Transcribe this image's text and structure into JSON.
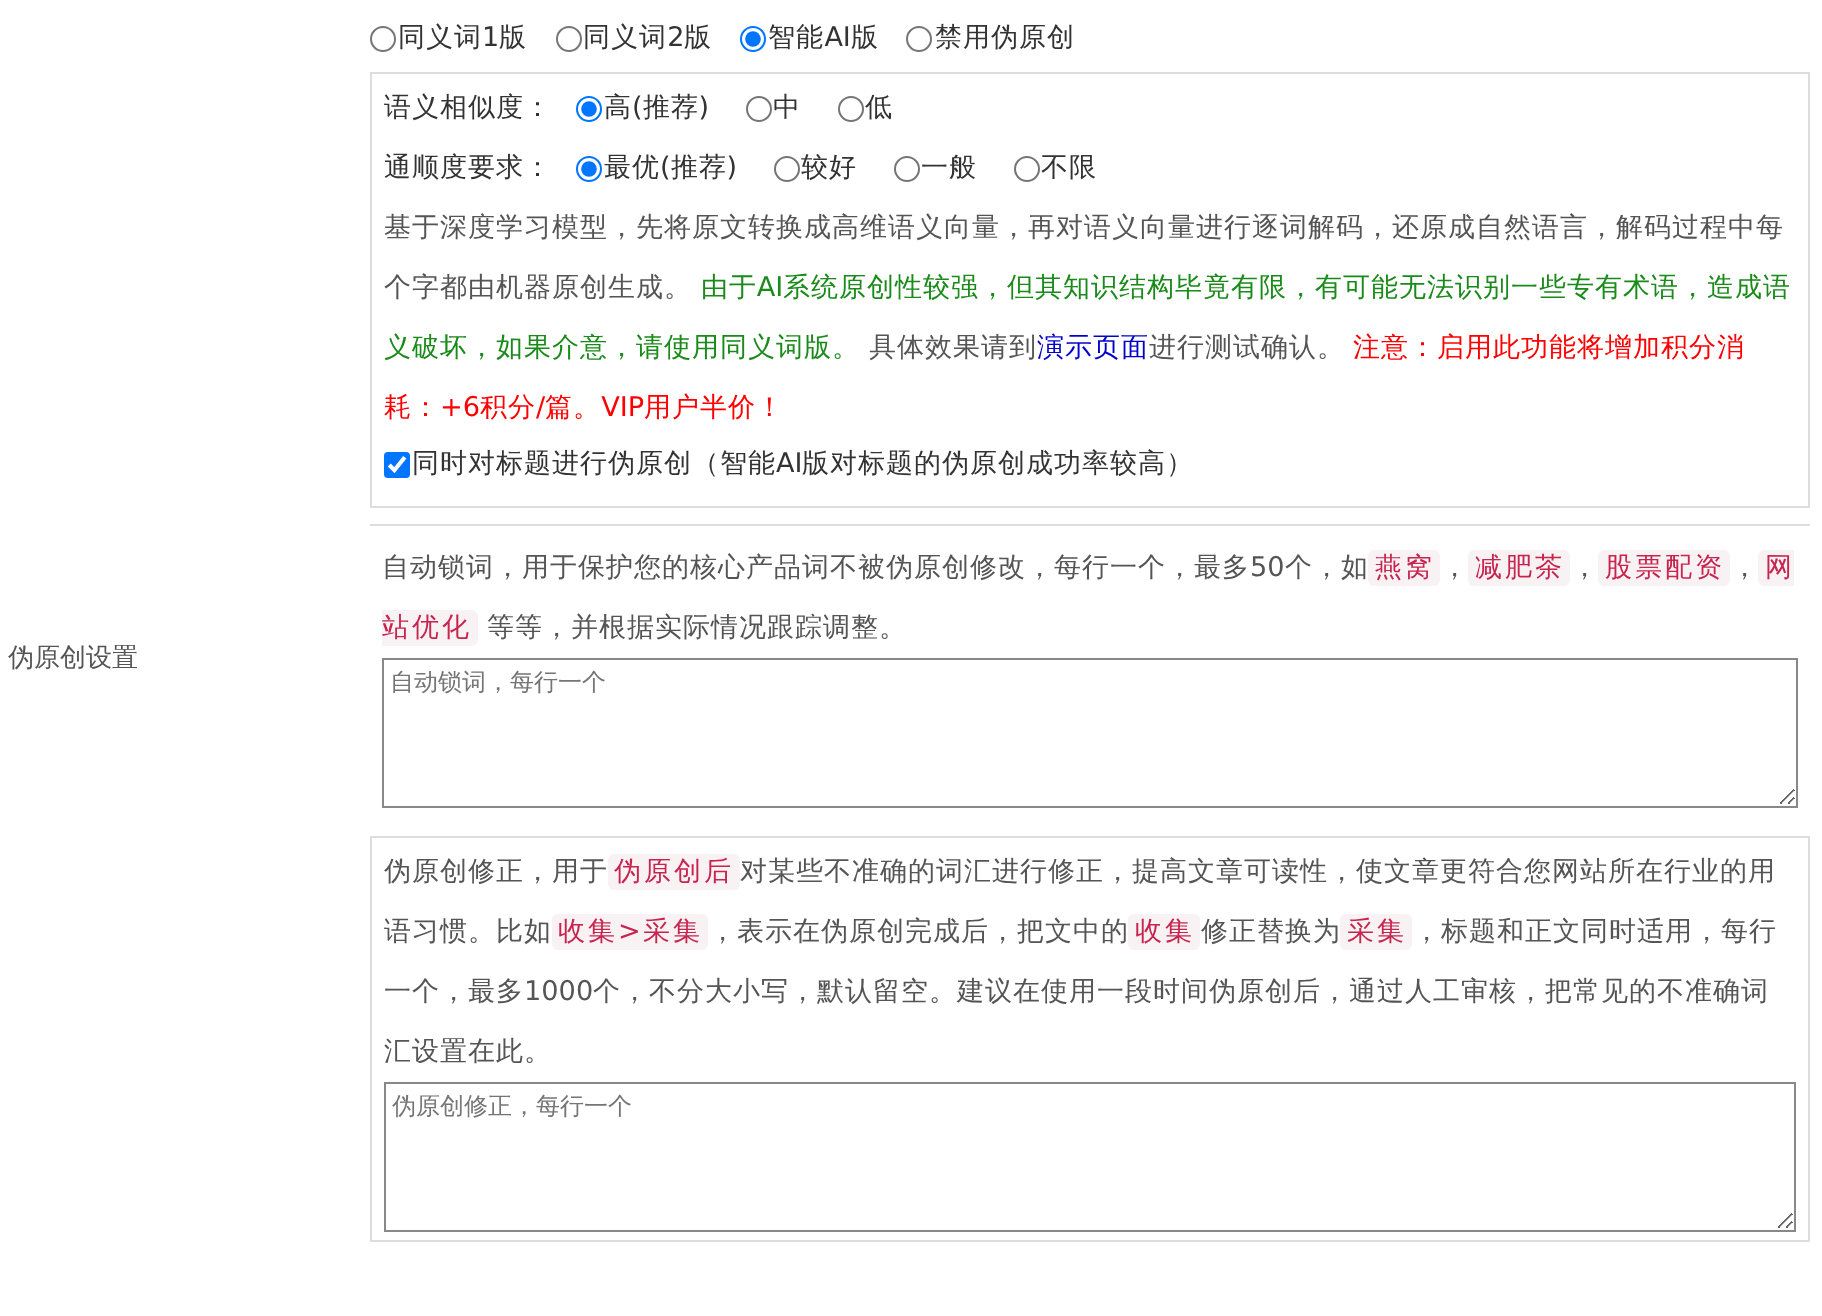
{
  "section_label": "伪原创设置",
  "mode_options": [
    {
      "label": "同义词1版",
      "selected": false
    },
    {
      "label": "同义词2版",
      "selected": false
    },
    {
      "label": "智能AI版",
      "selected": true
    },
    {
      "label": "禁用伪原创",
      "selected": false
    }
  ],
  "ai_settings": {
    "similarity": {
      "label": "语义相似度：",
      "options": [
        {
          "label": "高(推荐)",
          "selected": true
        },
        {
          "label": "中",
          "selected": false
        },
        {
          "label": "低",
          "selected": false
        }
      ]
    },
    "fluency": {
      "label": "通顺度要求：",
      "options": [
        {
          "label": "最优(推荐)",
          "selected": true
        },
        {
          "label": "较好",
          "selected": false
        },
        {
          "label": "一般",
          "selected": false
        },
        {
          "label": "不限",
          "selected": false
        }
      ]
    },
    "description": [
      {
        "kind": "text",
        "text": "基于深度学习模型，先将原文转换成高维语义向量，再对语义向量进行逐词解码，还原成自然语言，解码过程中每个字都由机器原创生成。 "
      },
      {
        "kind": "success",
        "text": "由于AI系统原创性较强，但其知识结构毕竟有限，有可能无法识别一些专有术语，造成语义破坏，如果介意，请使用同义词版。"
      },
      {
        "kind": "text",
        "text": " 具体效果请到"
      },
      {
        "kind": "link",
        "text": "演示页面"
      },
      {
        "kind": "text",
        "text": "进行测试确认。 "
      },
      {
        "kind": "warning",
        "text": "注意：启用此功能将增加积分消耗：+6积分/篇。VIP用户半价！"
      }
    ],
    "title_option": {
      "label": "同时对标题进行伪原创（智能AI版对标题的伪原创成功率较高）",
      "checked": true
    }
  },
  "lock_words": {
    "description": [
      {
        "kind": "text",
        "text": "自动锁词，用于保护您的核心产品词不被伪原创修改，每行一个，最多50个，如"
      },
      {
        "kind": "tag",
        "text": "燕窝"
      },
      {
        "kind": "text",
        "text": "，"
      },
      {
        "kind": "tag",
        "text": "减肥茶"
      },
      {
        "kind": "text",
        "text": "，"
      },
      {
        "kind": "tag",
        "text": "股票配资"
      },
      {
        "kind": "text",
        "text": "，"
      },
      {
        "kind": "tag",
        "text": "网站优化"
      },
      {
        "kind": "text",
        "text": " 等等，并根据实际情况跟踪调整。"
      }
    ],
    "placeholder": "自动锁词，每行一个"
  },
  "correction": {
    "description": [
      {
        "kind": "text",
        "text": "伪原创修正，用于"
      },
      {
        "kind": "tag",
        "text": "伪原创后"
      },
      {
        "kind": "text",
        "text": "对某些不准确的词汇进行修正，提高文章可读性，使文章更符合您网站所在行业的用语习惯。比如"
      },
      {
        "kind": "tag",
        "text": "收集>采集"
      },
      {
        "kind": "text",
        "text": "，表示在伪原创完成后，把文中的"
      },
      {
        "kind": "tag",
        "text": "收集"
      },
      {
        "kind": "text",
        "text": "修正替换为"
      },
      {
        "kind": "tag",
        "text": "采集"
      },
      {
        "kind": "text",
        "text": "，标题和正文同时适用，每行一个，最多1000个，不分大小写，默认留空。建议在使用一段时间伪原创后，通过人工审核，把常见的不准确词汇设置在此。"
      }
    ],
    "placeholder": "伪原创修正，每行一个"
  }
}
